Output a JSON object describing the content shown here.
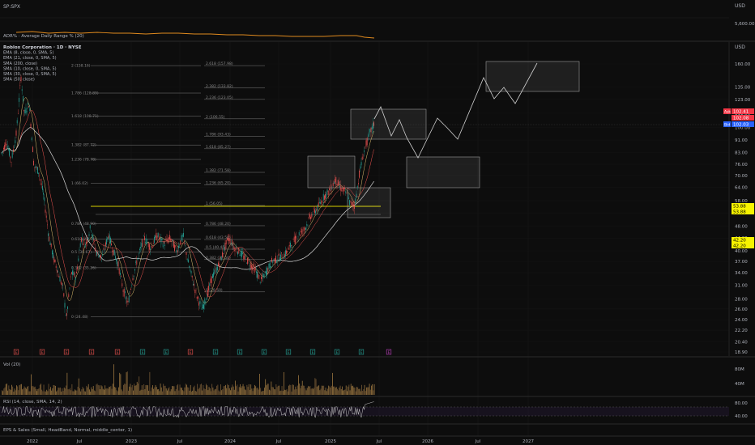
{
  "colors": {
    "bg": "#0d0d0d",
    "grid": "#1c1c1c",
    "text": "#b2b5be",
    "fib": "#8a8a8a",
    "yellow": "#f7f300",
    "red": "#f23645",
    "blue": "#2962ff",
    "orange": "#e08a1e",
    "up": "#26a69a",
    "down": "#ef5350",
    "box": "#b0b0b0"
  },
  "header": {
    "top_symbol": "SP:SPX",
    "top_currency": "USD",
    "top_price": "5,600.00",
    "adr_label": "ADR% · Average Daily Range % (20)",
    "main_currency": "USD"
  },
  "legend": [
    "Roblox Corporation · 1D · NYSE",
    "EMA (8, close, 0, SMA, 5)",
    "EMA (21, close, 0, SMA, 5)",
    "SMA (200, close)",
    "SMA (10, close, 0, SMA, 5)",
    "SMA (30, close, 0, SMA, 5)",
    "SMA (50, close)"
  ],
  "price_badges": {
    "ask_label": "Ask",
    "ask_value": "102.41",
    "last_value": "102.08",
    "bid_label": "Bid",
    "bid_value": "102.03",
    "yellow_a": "53.88",
    "yellow_b": "53.88",
    "yellow_c": "42.20",
    "yellow_d": "42.20"
  },
  "volume": {
    "label": "Vol (20)",
    "ticks": [
      "80M",
      "40M"
    ]
  },
  "rsi": {
    "label": "RSI (14, close, SMA, 14, 2)",
    "ticks": [
      "80.00",
      "40.00"
    ]
  },
  "eps_label": "EPS & Sales (Small, HeadBand, Normal, middle_center, 1)",
  "events": [
    "E",
    "E",
    "E",
    "E",
    "E",
    "E",
    "E",
    "E",
    "E",
    "E",
    "E",
    "E",
    "E",
    "E",
    "E",
    "E"
  ],
  "chart_data": {
    "type": "candlestick",
    "y_scale": "log",
    "y_ticks": [
      "160.00",
      "135.00",
      "123.00",
      "111.00",
      "100.00",
      "91.00",
      "83.00",
      "76.00",
      "70.00",
      "64.00",
      "58.00",
      "53.00",
      "48.00",
      "44.00",
      "40.00",
      "37.00",
      "34.00",
      "31.00",
      "28.00",
      "26.00",
      "24.00",
      "22.20",
      "20.40",
      "18.90"
    ],
    "x_ticks": [
      "2022",
      "Jul",
      "2023",
      "Jul",
      "2024",
      "Jul",
      "2025",
      "Jul",
      "2026",
      "Jul",
      "2027"
    ],
    "fib_left": [
      {
        "label": "2 (158.16)",
        "y": 158
      },
      {
        "label": "1.786 (128.89)",
        "y": 128.9
      },
      {
        "label": "1.618 (108.71)",
        "y": 108.7
      },
      {
        "label": "1.382 (87.72)",
        "y": 87.7
      },
      {
        "label": "1.236 (78.78)",
        "y": 78.8
      },
      {
        "label": "1 (66.02)",
        "y": 66
      },
      {
        "label": "0.786 (48.90)",
        "y": 48.9
      },
      {
        "label": "0.618 (43.71)",
        "y": 43.7
      },
      {
        "label": "0.5 (39.67)",
        "y": 39.7
      },
      {
        "label": "0.382 (35.26)",
        "y": 35.3
      },
      {
        "label": "0 (24.48)",
        "y": 24.5
      }
    ],
    "fib_right": [
      {
        "label": "2.618 (157.98)",
        "y": 158
      },
      {
        "label": "2.382 (133.82)",
        "y": 133.8
      },
      {
        "label": "2.236 (123.05)",
        "y": 123
      },
      {
        "label": "2 (106.55)",
        "y": 106.5
      },
      {
        "label": "1.786 (93.43)",
        "y": 93.4
      },
      {
        "label": "1.618 (85.27)",
        "y": 85.3
      },
      {
        "label": "1.382 (71.58)",
        "y": 71.6
      },
      {
        "label": "1.236 (65.20)",
        "y": 65.2
      },
      {
        "label": "1 (56.05)",
        "y": 56
      },
      {
        "label": "0.786 (48.20)",
        "y": 48.2
      },
      {
        "label": "0.618 (43.50)",
        "y": 43.5
      },
      {
        "label": "0.5 (40.45)",
        "y": 40.5
      },
      {
        "label": "0.382 (37.50)",
        "y": 37.5
      },
      {
        "label": "0 (29.50)",
        "y": 29.5
      }
    ]
  }
}
